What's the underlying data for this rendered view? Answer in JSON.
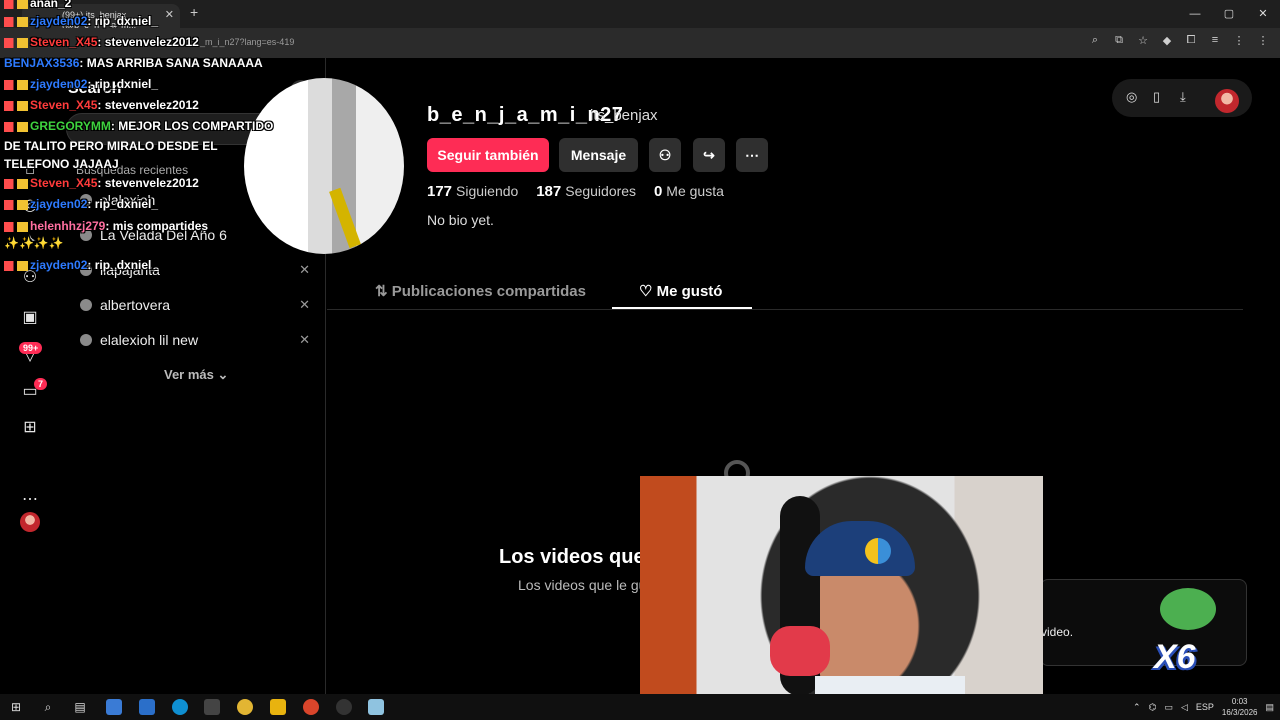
{
  "browser": {
    "tab_title": "(99+) its_benjax (@b_e_n_j_a_m...",
    "url": "_m_i_n27?lang=es-419"
  },
  "search_panel": {
    "title": "Search",
    "recent_title": "Búsquedas recientes",
    "recent": [
      "elalexioh",
      "La Velada Del Año 6",
      "llapajarita",
      "albertovera",
      "elalexioh lil new"
    ],
    "ver_mas": "Ver más"
  },
  "rail": {
    "activity_badge": "99+",
    "inbox_badge": "7"
  },
  "profile": {
    "username": "b_e_n_j_a_m_i_n27",
    "handle": "its_benjax",
    "follow_button": "Seguir también",
    "message_button": "Mensaje",
    "following_count": "177",
    "following_label": "Siguiendo",
    "followers_count": "187",
    "followers_label": "Seguidores",
    "likes_count": "0",
    "likes_label": "Me gusta",
    "bio": "No bio yet."
  },
  "tabs": {
    "shared": "Publicaciones compartidas",
    "liked": "Me gustó"
  },
  "empty_state": {
    "title": "Los videos que",
    "subtitle": "Los videos que le gu",
    "toast_text": "video."
  },
  "chat": [
    {
      "user": "anan_2",
      "msg": "",
      "color": "#ffffff"
    },
    {
      "user": "zjayden02",
      "msg": ": rip_dxniel_",
      "color": "#2e7bff"
    },
    {
      "user": "Steven_X45",
      "msg": ": stevenvelez2012",
      "color": "#ff3b3b"
    },
    {
      "user": "BENJAX3536",
      "msg": ": MAS ARRIBA SANA SANAAAA",
      "color": "#2e7bff"
    },
    {
      "user": "zjayden02",
      "msg": ": rip_dxniel_",
      "color": "#2e7bff"
    },
    {
      "user": "Steven_X45",
      "msg": ": stevenvelez2012",
      "color": "#ff3b3b"
    },
    {
      "user": "GREGORYMM",
      "msg": ": MEJOR LOS COMPARTIDO",
      "color": "#3fd43f"
    },
    {
      "user": "Steven_X45",
      "msg": ": stevenvelez2012",
      "color": "#ff3b3b"
    },
    {
      "user": "zjayden02",
      "msg": ": rip_dxniel_",
      "color": "#2e7bff"
    },
    {
      "user": "helenhhzj279",
      "msg": ": mis compartides",
      "color": "#ff6fa0"
    },
    {
      "user": "zjayden02",
      "msg": ": rip_dxniel_",
      "color": "#2e7bff"
    }
  ],
  "chat_wrap": "DE TALITO PERO MIRALO DESDE EL TELEFONO JAJAAJ",
  "chat_sparkles": "✨✨✨✨",
  "overlay": {
    "combo": "X6"
  },
  "taskbar": {
    "lang": "ESP",
    "time": "0:03",
    "date": "16/3/2026"
  }
}
